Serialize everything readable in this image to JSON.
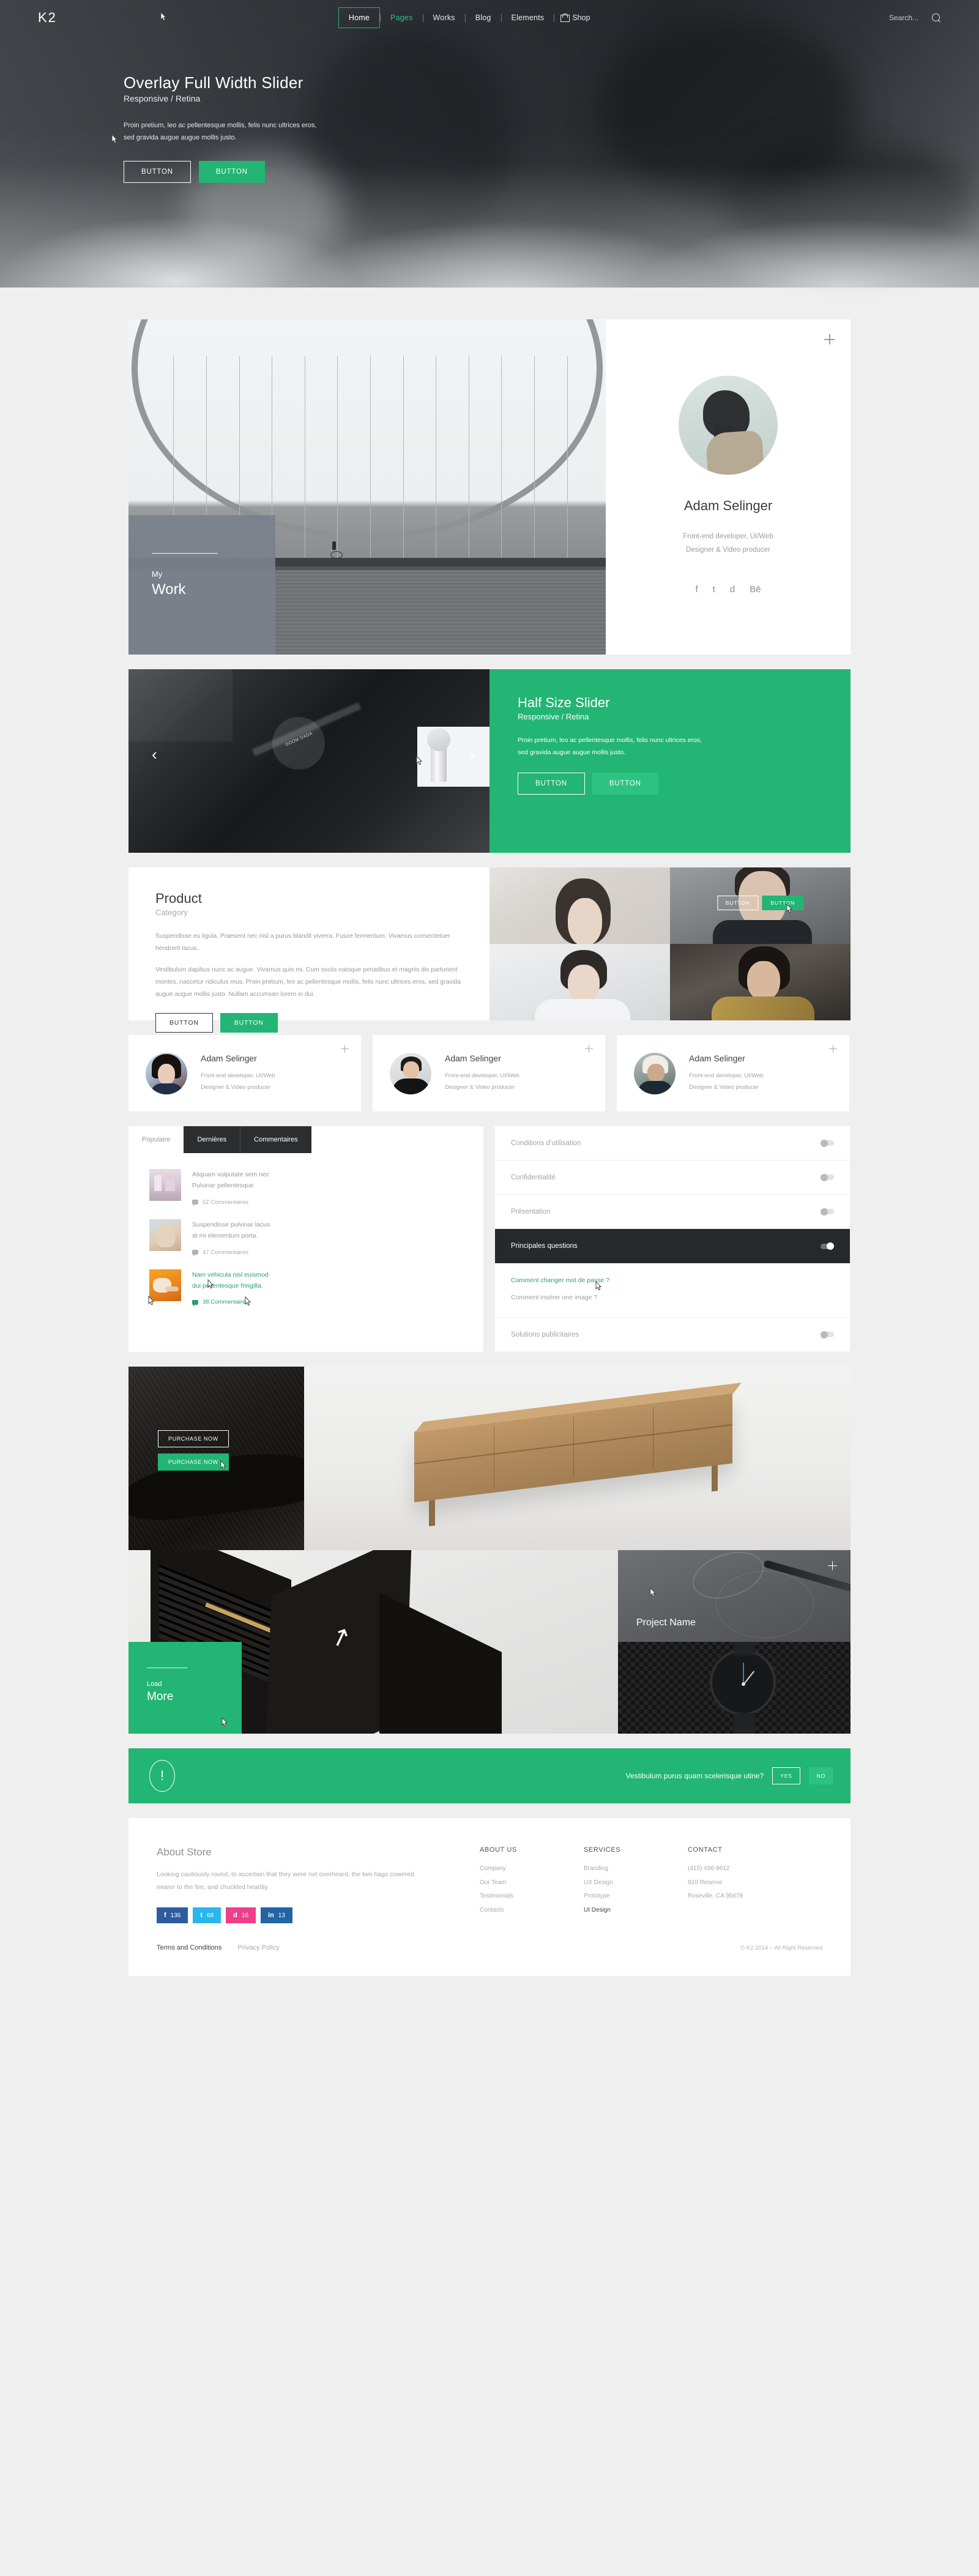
{
  "nav": {
    "brand": "K2",
    "links": [
      {
        "label": "Home",
        "state": "active"
      },
      {
        "label": "Pages",
        "state": "hover"
      },
      {
        "label": "Works",
        "state": "normal"
      },
      {
        "label": "Blog",
        "state": "normal"
      },
      {
        "label": "Elements",
        "state": "normal"
      }
    ],
    "shop_label": "Shop",
    "search_placeholder": "Search..."
  },
  "hero": {
    "title": "Overlay Full Width Slider",
    "subtitle": "Responsive / Retina",
    "text": "Proin pretium, leo ac pellentesque mollis, felis nunc ultrices eros, sed gravida augue augue mollis justo.",
    "btn_ghost": "BUTTON",
    "btn_solid": "BUTTON"
  },
  "work": {
    "overlay_small": "My",
    "overlay_big": "Work"
  },
  "profile": {
    "name": "Adam Selinger",
    "role_line1": "Front-end developer, UI/Web",
    "role_line2": "Designer & Video producer",
    "social": [
      "f",
      "t",
      "d",
      "Bē"
    ]
  },
  "half_slider": {
    "title": "Half Size Slider",
    "subtitle": "Responsive / Retina",
    "text": "Proin pretium, leo ac pellentesque mollis, felis nunc ultrices eros, sed gravida augue augue mollis justo.",
    "btn_ghost": "BUTTON",
    "btn_solid": "BUTTON",
    "arrow_prev": "‹",
    "arrow_next": "›",
    "thumb_caption": "DOOM DADA"
  },
  "product": {
    "title": "Product",
    "category": "Category",
    "paragraph1": "Suspendisse eu ligula. Praesent nec nisl a purus blandit viverra. Fusce fermentum. Vivamus consectetuer hendrerit lacus..",
    "paragraph2": "Vestibulum dapibus nunc ac augue. Vivamus quis mi. Cum sociis natoque penatibus et magnis dis parturient montes, nascetur ridiculus mus. Proin pretium, leo ac pellentesque mollis, felis nunc ultrices eros, sed gravida augue augue mollis justo. Nullam accumsan lorem in dui.",
    "btn_ghost": "BUTTON",
    "btn_solid": "BUTTON",
    "tile_btn_ghost": "BUTTON",
    "tile_btn_solid": "BUTTON"
  },
  "team": [
    {
      "name": "Adam Selinger",
      "role_line1": "Front-end developer, UI/Web",
      "role_line2": "Designer & Video producer"
    },
    {
      "name": "Adam Selinger",
      "role_line1": "Front-end developer, UI/Web",
      "role_line2": "Designer & Video producer"
    },
    {
      "name": "Adam Selinger",
      "role_line1": "Front-end developer, UI/Web",
      "role_line2": "Designer & Video producer"
    }
  ],
  "tabs": {
    "items": [
      {
        "label": "Populaire",
        "active": false
      },
      {
        "label": "Dernières",
        "active": true
      },
      {
        "label": "Commentaires",
        "active": true
      }
    ],
    "posts": [
      {
        "title_line1": "Aliquam vulputate sem nec",
        "title_line2": "Pulvinar pellentesque.",
        "comments": "52 Commentaires",
        "highlight": false
      },
      {
        "title_line1": "Suspendisse pulvinar lacus",
        "title_line2": "at mi elementum porta.",
        "comments": "47 Commentaires",
        "highlight": false
      },
      {
        "title_line1": "Nam vehicula nisl euismod",
        "title_line2": "dui pellentesque fringilla.",
        "comments": "38 Commentaires",
        "highlight": true
      }
    ]
  },
  "accordion": {
    "rows": [
      {
        "label": "Conditions d’utilisation",
        "open": false
      },
      {
        "label": "Confidentialité",
        "open": false
      },
      {
        "label": "Présentation",
        "open": false
      },
      {
        "label": "Principales questions",
        "open": true
      },
      {
        "label": "Solutions publicitaires",
        "open": false
      }
    ],
    "open_body": {
      "q1": "Comment changer mot de passe ?",
      "q2": "Comment insérer une image ?"
    }
  },
  "gallery": {
    "purchase_ghost": "PURCHASE NOW",
    "purchase_solid": "PURCHASE NOW",
    "load_small": "Load",
    "load_big": "More",
    "project_name": "Project Name"
  },
  "alert": {
    "icon": "!",
    "text": "Vestibulum purus quam scelerisque utine?",
    "yes": "YES",
    "no": "NO"
  },
  "footer": {
    "about_heading": "About Store",
    "about_text": "Looking cautiously round, to ascertain that they were not overheard, the two hags cowered nearer to the fire, and chuckled heartily.",
    "social_counts": [
      {
        "icon": "f",
        "count": "136",
        "color": "#2d5d9f"
      },
      {
        "icon": "t",
        "count": "68",
        "color": "#29b6ec"
      },
      {
        "icon": "d",
        "count": "16",
        "color": "#ef3f8b"
      },
      {
        "icon": "in",
        "count": "13",
        "color": "#2264a5"
      }
    ],
    "columns": [
      {
        "heading": "ABOUT US",
        "items": [
          {
            "label": "Company",
            "bold": false
          },
          {
            "label": "Our Team",
            "bold": false
          },
          {
            "label": "Testimonials",
            "bold": false
          },
          {
            "label": "Contacts",
            "bold": false
          }
        ]
      },
      {
        "heading": "SERVICES",
        "items": [
          {
            "label": "Branding",
            "bold": false
          },
          {
            "label": "UX Design",
            "bold": false
          },
          {
            "label": "Prototype",
            "bold": false
          },
          {
            "label": "UI Design",
            "bold": true
          }
        ]
      },
      {
        "heading": "CONTACT",
        "items": [
          {
            "label": "(415) 496-9612",
            "bold": false
          },
          {
            "label": "920 Reserve",
            "bold": false
          },
          {
            "label": "Roseville, CA 95678",
            "bold": false
          }
        ]
      }
    ],
    "terms": "Terms and Conditions",
    "privacy": "Privacy Policy",
    "copyright": "© K2 2014 – All Right Reserved"
  }
}
